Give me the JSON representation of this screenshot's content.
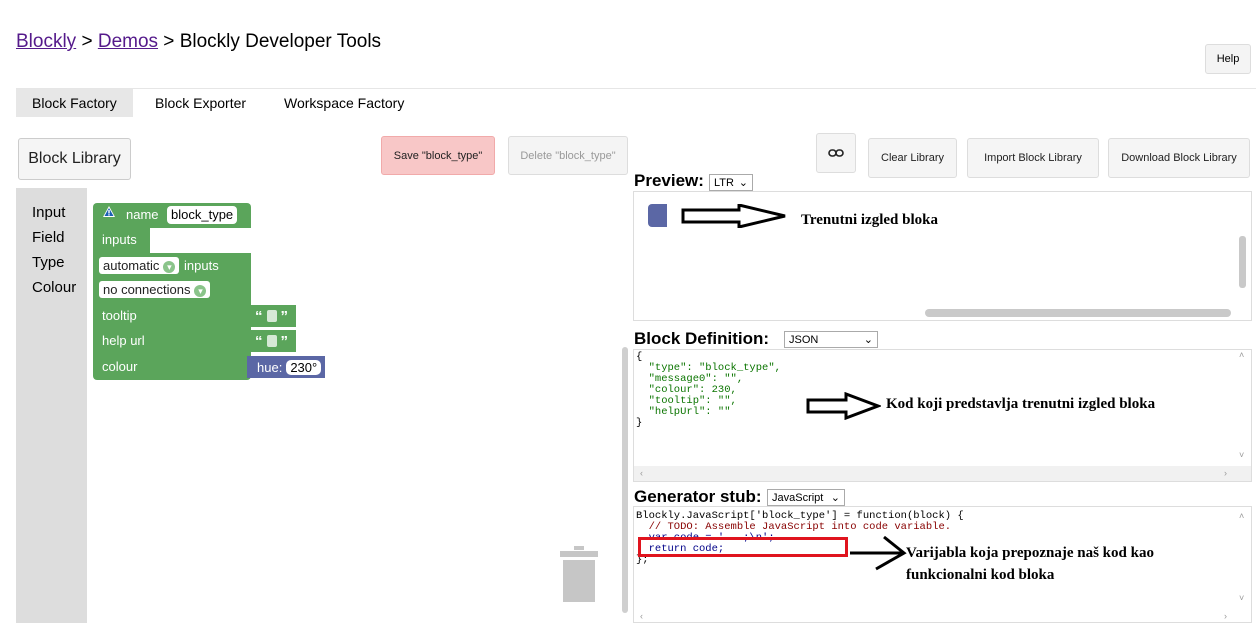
{
  "breadcrumb": {
    "link1": "Blockly",
    "sep1": " > ",
    "link2": "Demos",
    "sep2": " > ",
    "current": "Blockly Developer Tools"
  },
  "help_label": "Help",
  "tabs": [
    {
      "label": "Block Factory",
      "active": true
    },
    {
      "label": "Block Exporter"
    },
    {
      "label": "Workspace Factory"
    }
  ],
  "toolbar": {
    "block_library": "Block Library",
    "save": "Save \"block_type\"",
    "delete": "Delete \"block_type\"",
    "link_icon": "link-icon",
    "clear_library": "Clear Library",
    "import_library": "Import Block Library",
    "download_library": "Download Block Library"
  },
  "toolbox": {
    "items": [
      "Input",
      "Field",
      "Type",
      "Colour"
    ]
  },
  "factory_block": {
    "name_label": "name",
    "name_value": "block_type",
    "inputs_label": "inputs",
    "automatic": "automatic",
    "inputs_after": "inputs",
    "connections": "no connections",
    "tooltip": "tooltip",
    "help_url": "help url",
    "colour": "colour",
    "hue_label": "hue:",
    "hue_value": "230°",
    "colour_hex": "#5ba55b",
    "hue_block_hex": "#5b67a5"
  },
  "preview": {
    "title": "Preview:",
    "direction": "LTR",
    "annotation": "Trenutni izgled bloka",
    "block_color": "#5b67a5"
  },
  "definition": {
    "title": "Block Definition:",
    "format": "JSON",
    "annotation": "Kod koji predstavlja trenutni izgled bloka",
    "lines": [
      "{",
      "  \"type\": \"block_type\",",
      "  \"message0\": \"\",",
      "  \"colour\": 230,",
      "  \"tooltip\": \"\",",
      "  \"helpUrl\": \"\"",
      "}"
    ]
  },
  "generator": {
    "title": "Generator stub:",
    "language": "JavaScript",
    "annotation_line1": "Varijabla koja prepoznaje naš kod kao",
    "annotation_line2": "funkcionalni kod bloka",
    "lines": [
      "Blockly.JavaScript['block_type'] = function(block) {",
      "  // TODO: Assemble JavaScript into code variable.",
      "  var code = '...;\\n';",
      "  return code;",
      "};"
    ]
  }
}
